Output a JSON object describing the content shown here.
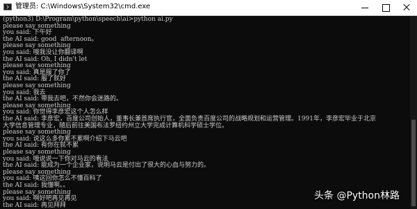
{
  "window": {
    "title": "管理员: C:\\Windows\\System32\\cmd.exe"
  },
  "console": {
    "lines": [
      "(python3) D:\\Program\\python\\speech\\ai>python ai.py",
      "please say something",
      "you said: 下午好",
      "the AI said: good  afternoon。",
      "please say something",
      "you said: 哦我没让你翻译啊",
      "the AI said: Oh, I didn't let",
      "please say something",
      "you said: 真是服了你了",
      "the AI said: 服了就好",
      "please say something",
      "you said: 我去",
      "the AI said: 带我去吧，不然你会迷路的。",
      "please say something",
      "you said: 你觉得李彦宏这个人怎么样",
      "the AI said: 李彦宏，百度公司创始人，董事长兼首席执行官，全面负责百度公司的战略规划和运营管理。1991年，李彦宏毕业于北京",
      "大学信息管理专业，随后前往美国布法罗纽约州立大学完成计算机科学硕士学位。",
      "please say something",
      "you said: 说这么多你累不累啊介绍下马云吧",
      "the AI said: 有你在就不累",
      "please say something",
      "you said: 哦说说一下你对马云的看法",
      "the AI said: 能成为一个企业家，说明马云是付出了很大的心血与努力的。",
      "please say something",
      "you said: 咦这回你怎么不懂百科了",
      "the AI said: 我懂啊。。",
      "please say something",
      "you said: 啊好吧再见再见",
      "the AI said: 再见拜拜"
    ]
  },
  "watermark": {
    "text": "头条 @Python林路"
  }
}
